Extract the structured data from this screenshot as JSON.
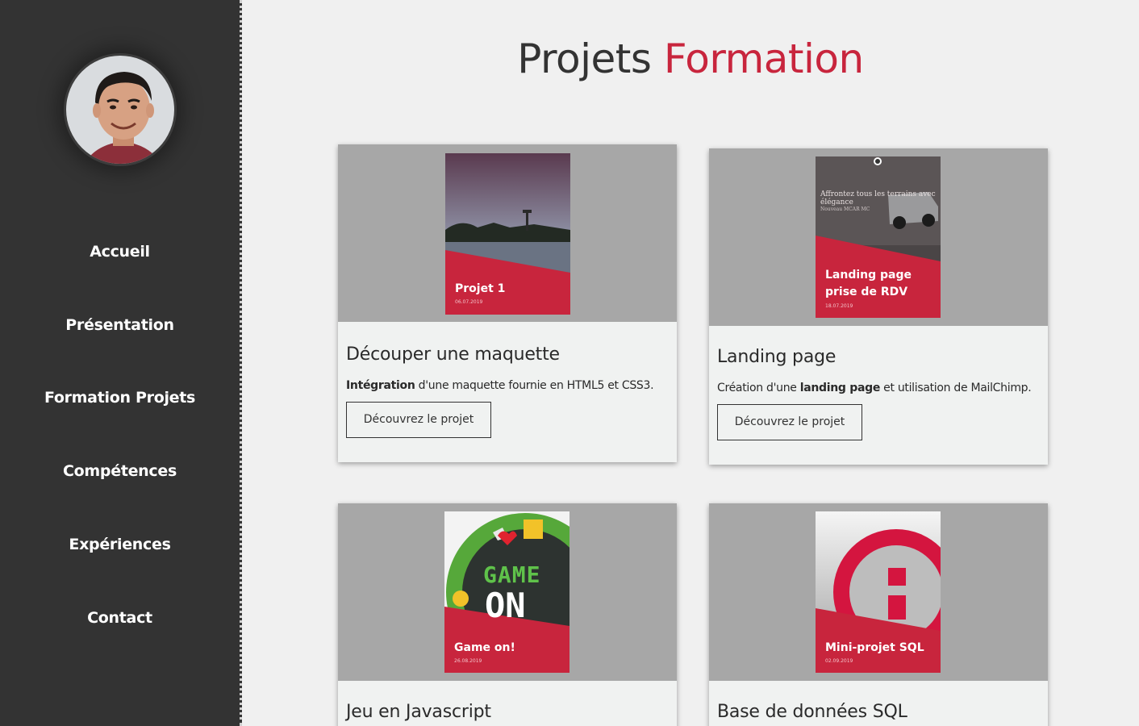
{
  "sidebar": {
    "avatar_alt": "avatar",
    "nav": [
      {
        "label": "Accueil"
      },
      {
        "label": "Présentation"
      },
      {
        "label": "Formation Projets"
      },
      {
        "label": "Compétences"
      },
      {
        "label": "Expériences"
      },
      {
        "label": "Contact"
      }
    ]
  },
  "header": {
    "title_part1": "Projets",
    "title_part2": "Formation"
  },
  "colors": {
    "accent": "#c8253d",
    "sidebar_bg": "#333333",
    "card_thumb_bg": "#a7a7a7"
  },
  "cards": [
    {
      "thumb_label": "Projet 1",
      "thumb_date": "06.07.2019",
      "title": "Découper une maquette",
      "desc_bold": "Intégration",
      "desc_rest": " d'une maquette fournie en HTML5 et CSS3.",
      "button": "Découvrez le projet"
    },
    {
      "thumb_label_line1": "Landing page",
      "thumb_label_line2": "prise de RDV",
      "thumb_date": "18.07.2019",
      "thumb_overlay_text": "Affrontez tous les terrains avec élégance",
      "thumb_overlay_sub": "Nouveau MCAR MC",
      "title": "Landing page",
      "desc_pre": "Création d'une ",
      "desc_bold": "landing page",
      "desc_rest": " et utilisation de MailChimp.",
      "button": "Découvrez le projet"
    },
    {
      "thumb_label": "Game on!",
      "thumb_date": "26.08.2019",
      "thumb_game_line1": "GAME",
      "thumb_game_line2": "ON",
      "title": "Jeu en Javascript"
    },
    {
      "thumb_label": "Mini-projet SQL",
      "thumb_date": "02.09.2019",
      "title": "Base de données SQL"
    }
  ]
}
